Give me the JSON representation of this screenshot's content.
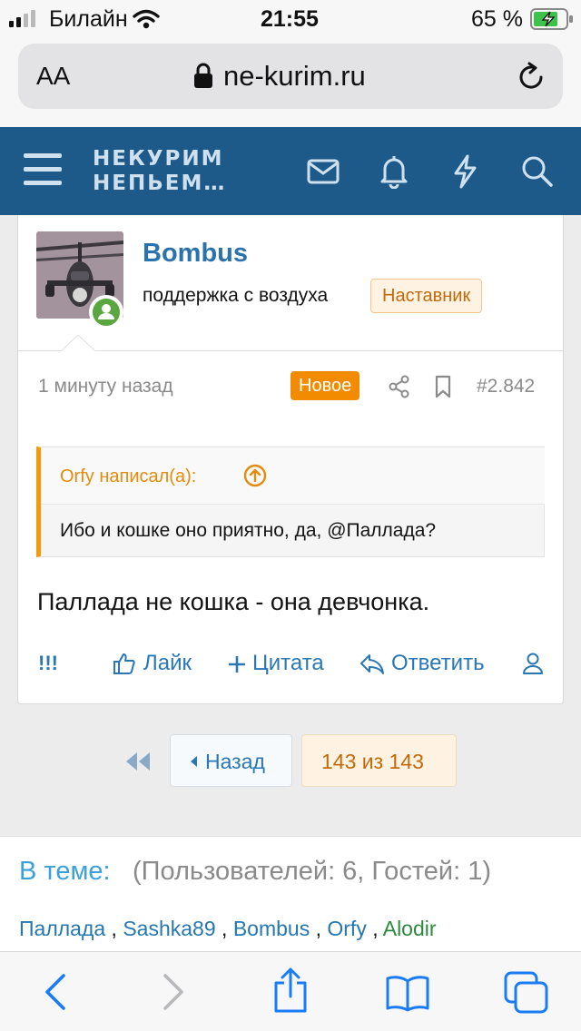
{
  "status_bar": {
    "carrier": "Билайн",
    "time": "21:55",
    "battery": "65 %"
  },
  "browser": {
    "text_size": "AA",
    "domain": "ne-kurim.ru"
  },
  "header": {
    "logo_line1": "НЕКУРИМ",
    "logo_line2": "НЕПЬЕМ…"
  },
  "post": {
    "author": "Bombus",
    "user_title": "поддержка с воздуха",
    "badge": "Наставник",
    "time": "1 минуту назад",
    "new_badge": "Новое",
    "post_number": "#2.842",
    "quote": {
      "author": "Orfy написал(а):",
      "text": "Ибо и кошке оно приятно, да, @Паллада?"
    },
    "body": "Паллада не кошка - она девчонка.",
    "actions": {
      "report": "!!!",
      "like": "Лайк",
      "quote": "Цитата",
      "reply": "Ответить"
    }
  },
  "pagination": {
    "back": "Назад",
    "position": "143 из 143"
  },
  "online": {
    "label": "В теме:",
    "counts": "(Пользователей: 6, Гостей: 1)",
    "users": [
      {
        "name": "Паллада",
        "color": "#2577b1"
      },
      {
        "name": "Sashka89",
        "color": "#2577b1"
      },
      {
        "name": "Bombus",
        "color": "#2577b1"
      },
      {
        "name": "Orfy",
        "color": "#2577b1"
      },
      {
        "name": "Alodir",
        "color": "#2b8a3e"
      }
    ],
    "separator": ","
  },
  "colors": {
    "header": "#1d5a89",
    "accent": "#f28b00",
    "link": "#2977b4",
    "ios_blue": "#1a7cf5"
  }
}
